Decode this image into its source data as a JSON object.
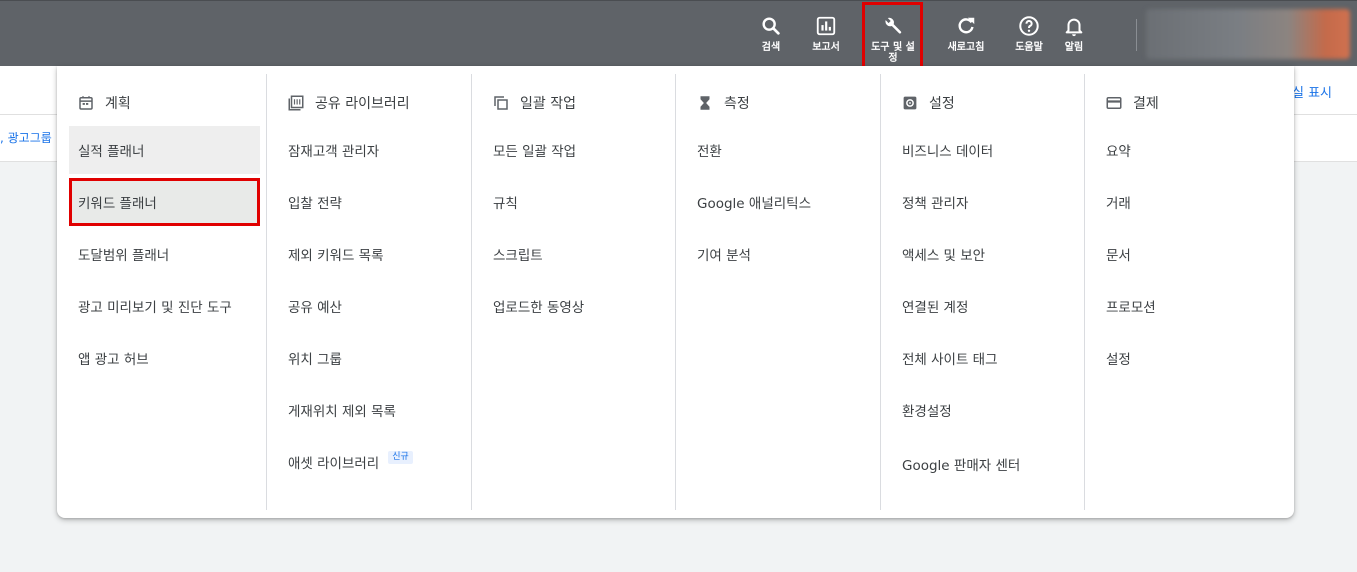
{
  "topbar": {
    "buttons": [
      {
        "label": "검색",
        "icon": "search-icon"
      },
      {
        "label": "보고서",
        "icon": "reports-icon"
      },
      {
        "label": "도구 및 설정",
        "icon": "wrench-icon"
      },
      {
        "label": "새로고침",
        "icon": "refresh-icon"
      },
      {
        "label": "도움말",
        "icon": "help-icon"
      },
      {
        "label": "알림",
        "icon": "bell-icon"
      }
    ]
  },
  "page": {
    "right_link": "실 표시",
    "breadcrumb": ", 광고그룹"
  },
  "menu": {
    "columns": [
      {
        "title": "계획",
        "icon": "calendar-icon",
        "items": [
          "실적 플래너",
          "키워드 플래너",
          "도달범위 플래너",
          "광고 미리보기 및 진단 도구",
          "앱 광고 허브"
        ]
      },
      {
        "title": "공유 라이브러리",
        "icon": "library-icon",
        "items": [
          "잠재고객 관리자",
          "입찰 전략",
          "제외 키워드 목록",
          "공유 예산",
          "위치 그룹",
          "게재위치 제외 목록",
          "애셋 라이브러리"
        ],
        "badge": "신규"
      },
      {
        "title": "일괄 작업",
        "icon": "copy-stack-icon",
        "items": [
          "모든 일괄 작업",
          "규칙",
          "스크립트",
          "업로드한 동영상"
        ]
      },
      {
        "title": "측정",
        "icon": "hourglass-icon",
        "items": [
          "전환",
          "Google 애널리틱스",
          "기여 분석"
        ]
      },
      {
        "title": "설정",
        "icon": "settings-gear-icon",
        "items": [
          "비즈니스 데이터",
          "정책 관리자",
          "액세스 및 보안",
          "연결된 계정",
          "전체 사이트 태그",
          "환경설정",
          "Google 판매자 센터"
        ]
      },
      {
        "title": "결제",
        "icon": "credit-card-icon",
        "items": [
          "요약",
          "거래",
          "문서",
          "프로모션",
          "설정"
        ]
      }
    ]
  }
}
